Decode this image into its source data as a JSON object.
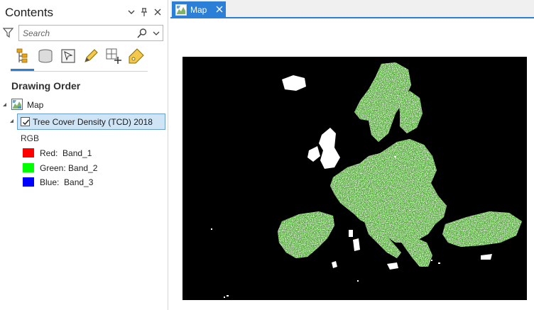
{
  "contents": {
    "title": "Contents",
    "search_placeholder": "Search",
    "section_title": "Drawing Order",
    "tools": [
      "list-by-drawing-order-icon",
      "list-by-data-source-icon",
      "list-by-selection-icon",
      "list-by-editing-icon",
      "list-by-snapping-icon",
      "list-by-labeling-icon"
    ],
    "map_node_label": "Map",
    "layer_label": "Tree Cover Density (TCD) 2018",
    "layer_checked": true,
    "symbology_label": "RGB",
    "bands": [
      {
        "label": "Red:  Band_1",
        "color": "#ff0000"
      },
      {
        "label": "Green: Band_2",
        "color": "#00ff00"
      },
      {
        "label": "Blue:  Band_3",
        "color": "#0000ff"
      }
    ]
  },
  "map_view": {
    "tab_label": "Map",
    "background_color": "#000000",
    "accent_color": "#2b7fd6"
  }
}
